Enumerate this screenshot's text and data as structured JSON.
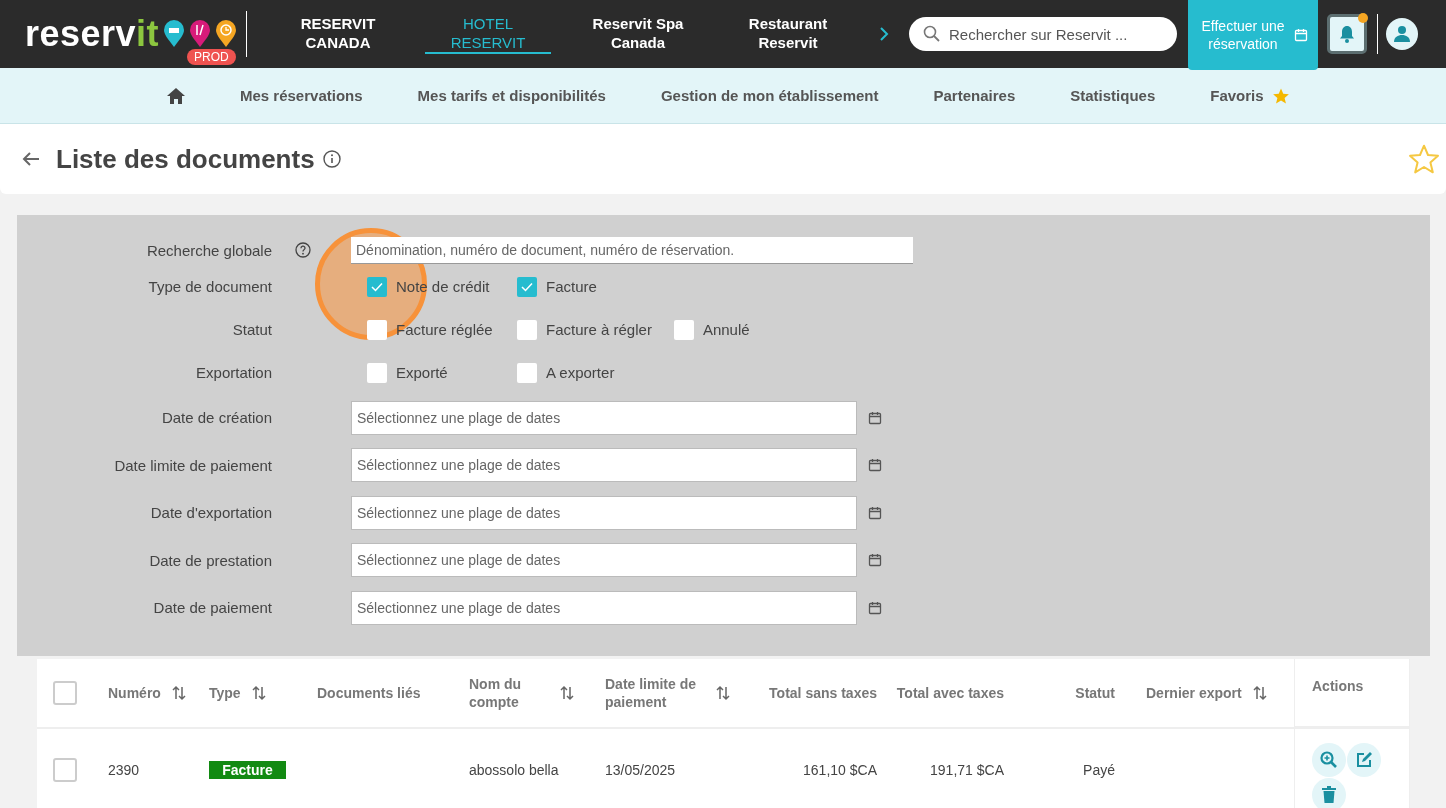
{
  "header": {
    "logo_main": "reserv",
    "logo_accent": "it",
    "env_badge": "PROD",
    "tabs": [
      {
        "label": "RESERVIT CANADA",
        "selected": false
      },
      {
        "label": "HOTEL RESERVIT",
        "selected": true
      },
      {
        "label": "Reservit Spa Canada",
        "selected": false
      },
      {
        "label": "Restaurant Reservit",
        "selected": false
      }
    ],
    "search": {
      "placeholder": "Rechercher sur Reservit ..."
    },
    "booking_button": "Effectuer une réservation",
    "notifications": {
      "unread": true
    }
  },
  "menu": {
    "items": [
      {
        "label": "Mes réservations"
      },
      {
        "label": "Mes tarifs et disponibilités"
      },
      {
        "label": "Gestion de mon établissement"
      },
      {
        "label": "Partenaires"
      },
      {
        "label": "Statistiques"
      },
      {
        "label": "Favoris",
        "starred": true
      }
    ]
  },
  "page": {
    "title": "Liste des documents",
    "favorite": false
  },
  "filters": [
    {
      "label": "Recherche globale",
      "kind": "search",
      "help": true,
      "placeholder": "Dénomination, numéro de document, numéro de réservation."
    },
    {
      "label": "Type de document",
      "kind": "checkboxes",
      "options": [
        {
          "label": "Note de crédit",
          "checked": true
        },
        {
          "label": "Facture",
          "checked": true
        }
      ]
    },
    {
      "label": "Statut",
      "kind": "checkboxes",
      "options": [
        {
          "label": "Facture réglée",
          "checked": false
        },
        {
          "label": "Facture à régler",
          "checked": false
        },
        {
          "label": "Annulé",
          "checked": false
        }
      ]
    },
    {
      "label": "Exportation",
      "kind": "checkboxes",
      "options": [
        {
          "label": "Exporté",
          "checked": false
        },
        {
          "label": "A exporter",
          "checked": false
        }
      ]
    },
    {
      "label": "Date de création",
      "kind": "daterange",
      "placeholder": "Sélectionnez une plage de dates"
    },
    {
      "label": "Date limite de paiement",
      "kind": "daterange",
      "placeholder": "Sélectionnez une plage de dates"
    },
    {
      "label": "Date d'exportation",
      "kind": "daterange",
      "placeholder": "Sélectionnez une plage de dates"
    },
    {
      "label": "Date de prestation",
      "kind": "daterange",
      "placeholder": "Sélectionnez une plage de dates"
    },
    {
      "label": "Date de paiement",
      "kind": "daterange",
      "placeholder": "Sélectionnez une plage de dates"
    }
  ],
  "table": {
    "all_selected": false,
    "columns": [
      {
        "label": "Numéro",
        "sortable": true
      },
      {
        "label": "Type",
        "sortable": true
      },
      {
        "label": "Documents liés",
        "sortable": false
      },
      {
        "label": "Nom du compte",
        "sortable": true
      },
      {
        "label": "Date limite de paiement",
        "sortable": true
      },
      {
        "label": "Total sans taxes",
        "sortable": false
      },
      {
        "label": "Total avec taxes",
        "sortable": false
      },
      {
        "label": "Statut",
        "sortable": false
      },
      {
        "label": "Dernier export",
        "sortable": true
      },
      {
        "label": "Actions",
        "sortable": false
      }
    ],
    "rows": [
      {
        "selected": false,
        "numero": "2390",
        "type": "Facture",
        "nom": "abossolo bella",
        "date": "13/05/2025",
        "total_ht": "161,10 $CA",
        "total_ttc": "191,71 $CA",
        "statut": "Payé"
      }
    ]
  }
}
